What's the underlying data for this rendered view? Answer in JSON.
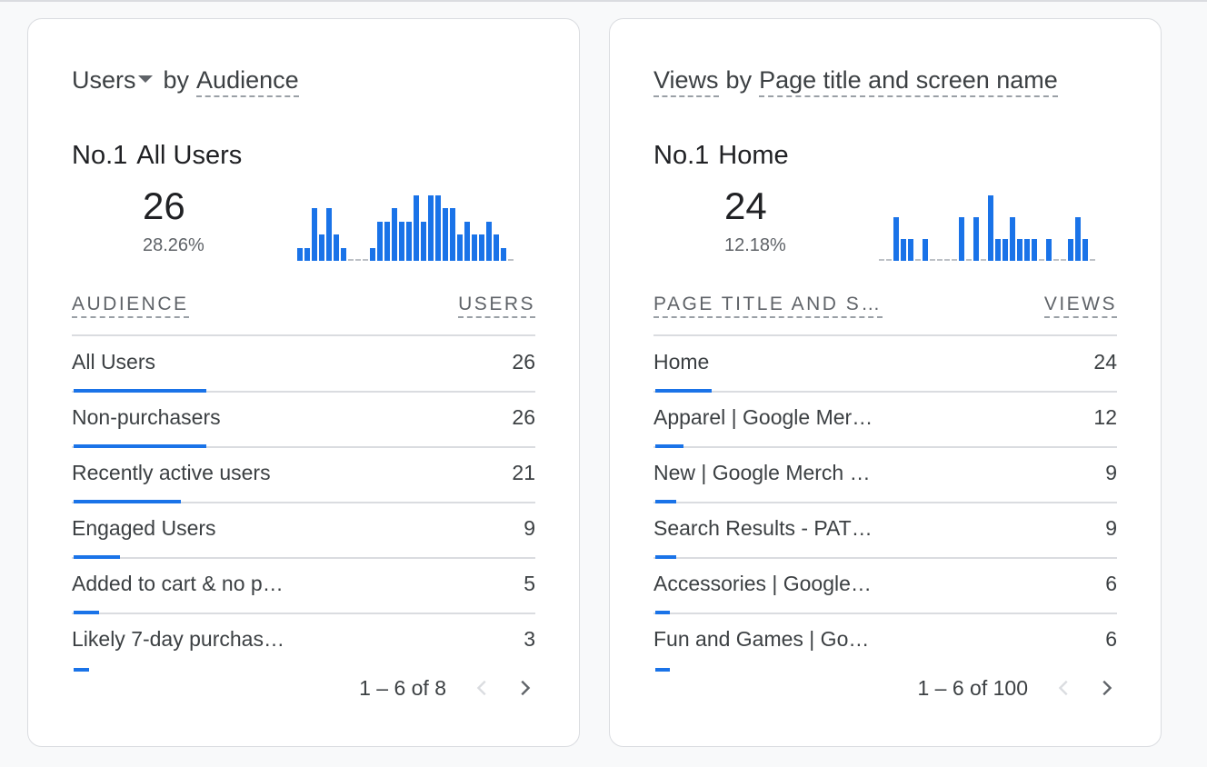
{
  "cards": [
    {
      "title": {
        "metric": "Users",
        "by": "by",
        "dimension": "Audience",
        "metric_has_dropdown": true
      },
      "top": {
        "rank": "No.1",
        "name": "All Users",
        "value": "26",
        "percent": "28.26%"
      },
      "sparkline": [
        1,
        1,
        4,
        2,
        4,
        2,
        1,
        0,
        0,
        0,
        1,
        3,
        3,
        4,
        3,
        3,
        5,
        3,
        5,
        5,
        4,
        4,
        2,
        3,
        2,
        2,
        3,
        2,
        1,
        0
      ],
      "table": {
        "col_dimension": "AUDIENCE",
        "col_metric": "USERS",
        "rows": [
          {
            "label": "All Users",
            "value": "26",
            "share": 1.0
          },
          {
            "label": "Non-purchasers",
            "value": "26",
            "share": 1.0
          },
          {
            "label": "Recently active users",
            "value": "21",
            "share": 0.808
          },
          {
            "label": "Engaged Users",
            "value": "9",
            "share": 0.346
          },
          {
            "label": "Added to cart & no p…",
            "value": "5",
            "share": 0.192
          },
          {
            "label": "Likely 7-day purchas…",
            "value": "3",
            "share": 0.115
          }
        ]
      },
      "pagination": {
        "text": "1 – 6 of 8",
        "prev_enabled": false,
        "next_enabled": true
      }
    },
    {
      "title": {
        "metric": "Views",
        "by": "by",
        "dimension": "Page title and screen name",
        "metric_has_dropdown": false
      },
      "top": {
        "rank": "No.1",
        "name": "Home",
        "value": "24",
        "percent": "12.18%"
      },
      "sparkline": [
        0,
        0,
        2,
        1,
        1,
        0,
        1,
        0,
        0,
        0,
        0,
        2,
        0,
        2,
        0,
        3,
        1,
        1,
        2,
        1,
        1,
        1,
        0,
        1,
        0,
        0,
        1,
        2,
        1,
        0
      ],
      "table": {
        "col_dimension": "PAGE TITLE AND S…",
        "col_metric": "VIEWS",
        "rows": [
          {
            "label": "Home",
            "value": "24",
            "share": 1.0
          },
          {
            "label": "Apparel | Google Mer…",
            "value": "12",
            "share": 0.5
          },
          {
            "label": "New | Google Merch …",
            "value": "9",
            "share": 0.375
          },
          {
            "label": "Search Results - PAT…",
            "value": "9",
            "share": 0.375
          },
          {
            "label": "Accessories | Google…",
            "value": "6",
            "share": 0.25
          },
          {
            "label": "Fun and Games | Go…",
            "value": "6",
            "share": 0.25
          }
        ]
      },
      "pagination": {
        "text": "1 – 6 of 100",
        "prev_enabled": false,
        "next_enabled": true
      }
    }
  ],
  "colors": {
    "accent": "#1a73e8",
    "zero_line": "#bdc1c6",
    "rule": "#dadce0",
    "text": "#3c4043",
    "muted": "#5f6368"
  }
}
